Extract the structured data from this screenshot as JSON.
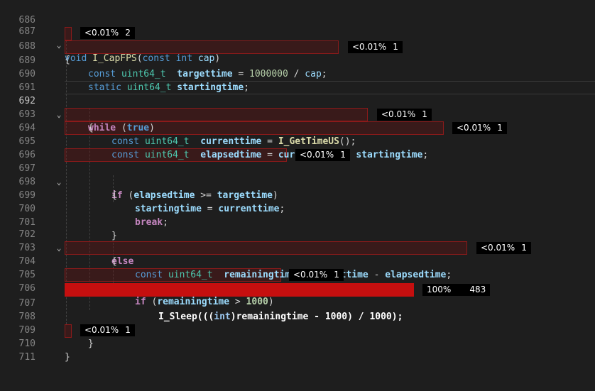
{
  "line_numbers": [
    "686",
    "687",
    "688",
    "689",
    "690",
    "691",
    "692",
    "693",
    "694",
    "695",
    "696",
    "697",
    "698",
    "699",
    "700",
    "701",
    "702",
    "703",
    "704",
    "705",
    "706",
    "707",
    "708",
    "709",
    "710",
    "711"
  ],
  "fold_marker": "⌄",
  "code": {
    "l687": {
      "t1": "void",
      "t2": "I_CapFPS",
      "t3": "(",
      "t4": "const",
      "t5": "int",
      "t6": "cap",
      "t7": ")"
    },
    "l688": {
      "t1": "{"
    },
    "l689": {
      "t1": "const",
      "t2": "uint64_t",
      "t3": "targettime",
      "t4": " = ",
      "t5": "1000000",
      "t6": " / ",
      "t7": "cap",
      "t8": ";"
    },
    "l690": {
      "t1": "static",
      "t2": "uint64_t",
      "t3": "startingtime",
      "t4": ";"
    },
    "l692": {
      "t1": "while",
      "t2": " (",
      "t3": "true",
      "t4": ")"
    },
    "l693": {
      "t1": "{"
    },
    "l694": {
      "t1": "const",
      "t2": "uint64_t",
      "t3": "currenttime",
      "t4": " = ",
      "t5": "I_GetTimeUS",
      "t6": "();"
    },
    "l695": {
      "t1": "const",
      "t2": "uint64_t",
      "t3": "elapsedtime",
      "t4": " = ",
      "t5": "currenttime",
      "t6": " - ",
      "t7": "startingtime",
      "t8": ";"
    },
    "l697": {
      "t1": "if",
      "t2": " (",
      "t3": "elapsedtime",
      "t4": " >= ",
      "t5": "targettime",
      "t6": ")"
    },
    "l698": {
      "t1": "{"
    },
    "l699": {
      "t1": "startingtime",
      "t2": " = ",
      "t3": "currenttime",
      "t4": ";"
    },
    "l700": {
      "t1": "break",
      "t2": ";"
    },
    "l701": {
      "t1": "}"
    },
    "l702": {
      "t1": "else"
    },
    "l703": {
      "t1": "{"
    },
    "l704": {
      "t1": "const",
      "t2": "uint64_t",
      "t3": "remainingtime",
      "t4": " = ",
      "t5": "targettime",
      "t6": " - ",
      "t7": "elapsedtime",
      "t8": ";"
    },
    "l706": {
      "t1": "if",
      "t2": " (",
      "t3": "remainingtime",
      "t4": " > ",
      "t5": "1000",
      "t6": ")"
    },
    "l707": {
      "t1": "I_Sleep",
      "t2": "(((",
      "t3": "int",
      "t4": ")",
      "t5": "remainingtime",
      "t6": " - ",
      "t7": "1000",
      "t8": ") / ",
      "t9": "1000",
      "t10": ");"
    },
    "l708": {
      "t1": "}"
    },
    "l709": {
      "t1": "}"
    },
    "l710": {
      "t1": "}"
    }
  },
  "badges": {
    "b688": {
      "pct": "<0.01%",
      "count": "2"
    },
    "b689": {
      "pct": "<0.01%",
      "count": "1"
    },
    "b694": {
      "pct": "<0.01%",
      "count": "1"
    },
    "b695": {
      "pct": "<0.01%",
      "count": "1"
    },
    "b697": {
      "pct": "<0.01%",
      "count": "1"
    },
    "b704": {
      "pct": "<0.01%",
      "count": "1"
    },
    "b706": {
      "pct": "<0.01%",
      "count": "1"
    },
    "b707": {
      "pct": "100%",
      "count": "483"
    },
    "b710": {
      "pct": "<0.01%",
      "count": "1"
    }
  },
  "colors": {
    "background": "#1e1e1e",
    "hot_line": "#c50f0f",
    "cold_border": "#8b1a1a",
    "badge_bg": "#000000"
  }
}
